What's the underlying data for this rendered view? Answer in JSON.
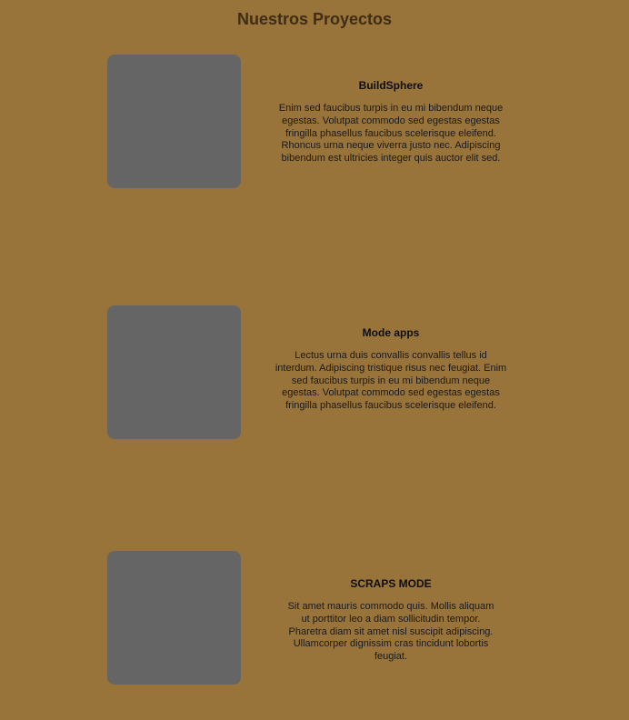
{
  "header": {
    "title": "Nuestros Proyectos"
  },
  "projects": [
    {
      "name": "BuildSphere",
      "description": "Enim sed faucibus turpis in eu mi bibendum neque egestas. Volutpat  commodo sed egestas egestas fringilla phasellus faucibus scelerisque  eleifend. Rhoncus urna neque viverra justo nec. Adipiscing bibendum est  ultricies integer quis auctor elit sed."
    },
    {
      "name": "Mode apps",
      "description": "Lectus urna duis convallis convallis tellus id interdum. Adipiscing  tristique risus nec feugiat. Enim sed faucibus turpis in eu mi bibendum neque egestas. Volutpat commodo sed egestas egestas fringilla phasellus  faucibus scelerisque eleifend."
    },
    {
      "name": "SCRAPS MODE",
      "description": "Sit amet mauris commodo quis. Mollis aliquam ut porttitor leo a diam  sollicitudin tempor. Pharetra diam sit amet nisl suscipit adipiscing.  Ullamcorper dignissim cras tincidunt lobortis feugiat."
    }
  ],
  "colors": {
    "background": "#98733a",
    "placeholder": "#656565",
    "title": "#3f2e15"
  }
}
